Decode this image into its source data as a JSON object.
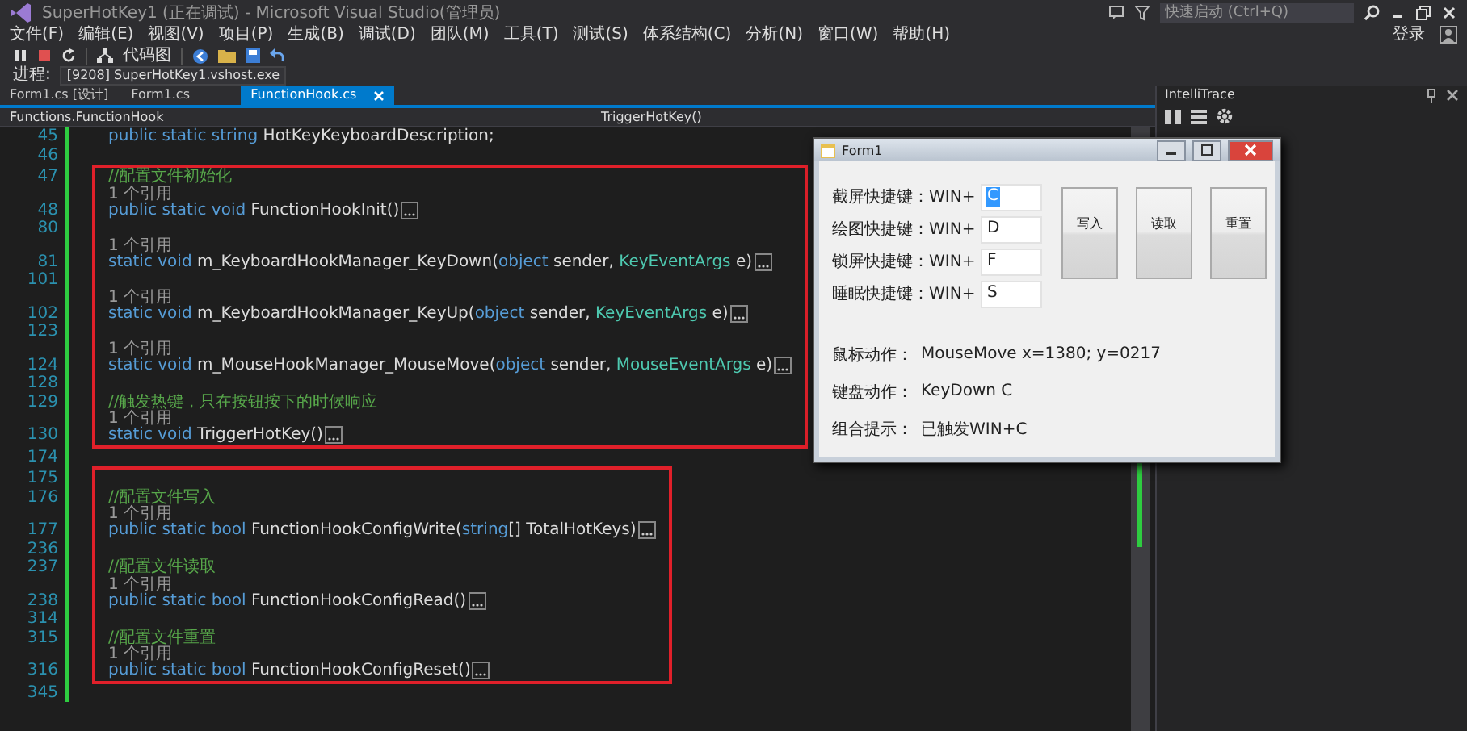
{
  "window": {
    "title": "SuperHotKey1 (正在调试) - Microsoft Visual Studio(管理员)",
    "quick_launch": {
      "placeholder": "快速启动 (Ctrl+Q)"
    },
    "sign_in": "登录"
  },
  "menu": [
    "文件(F)",
    "编辑(E)",
    "视图(V)",
    "项目(P)",
    "生成(B)",
    "调试(D)",
    "团队(M)",
    "工具(T)",
    "测试(S)",
    "体系结构(C)",
    "分析(N)",
    "窗口(W)",
    "帮助(H)"
  ],
  "toolbar": {
    "code_map": "代码图"
  },
  "process": {
    "label": "进程:",
    "value": "[9208] SuperHotKey1.vshost.exe"
  },
  "tabs": [
    {
      "label": "Form1.cs [设计]",
      "selected": false
    },
    {
      "label": "Form1.cs",
      "selected": false
    },
    {
      "label": "FunctionHook.cs",
      "selected": true
    }
  ],
  "nav": {
    "class": "Functions.FunctionHook",
    "member": "TriggerHotKey()"
  },
  "code_groups": [
    {
      "boxed": false,
      "lines": [
        {
          "number": "45",
          "tokens": [
            {
              "kind": "keyword",
              "text": "public static string "
            },
            {
              "kind": "plain",
              "text": "HotKeyKeyboardDescription;"
            }
          ]
        },
        {
          "number": "46"
        }
      ]
    },
    {
      "boxed": true,
      "lines": [
        {
          "number": "47",
          "tokens": [
            {
              "kind": "comment",
              "text": "//配置文件初始化"
            }
          ]
        },
        {
          "number": "48",
          "codelens": "1 个引用",
          "collapsed": true,
          "tokens": [
            {
              "kind": "keyword",
              "text": "public static void "
            },
            {
              "kind": "plain",
              "text": "FunctionHookInit()"
            }
          ]
        },
        {
          "number": "80"
        },
        {
          "number": "81",
          "codelens": "1 个引用",
          "collapsed": true,
          "tokens": [
            {
              "kind": "keyword",
              "text": "static void "
            },
            {
              "kind": "plain",
              "text": "m_KeyboardHookManager_KeyDown("
            },
            {
              "kind": "keyword",
              "text": "object "
            },
            {
              "kind": "plain",
              "text": "sender, "
            },
            {
              "kind": "type",
              "text": "KeyEventArgs "
            },
            {
              "kind": "plain",
              "text": "e)"
            }
          ]
        },
        {
          "number": "101"
        },
        {
          "number": "102",
          "codelens": "1 个引用",
          "collapsed": true,
          "tokens": [
            {
              "kind": "keyword",
              "text": "static void "
            },
            {
              "kind": "plain",
              "text": "m_KeyboardHookManager_KeyUp("
            },
            {
              "kind": "keyword",
              "text": "object "
            },
            {
              "kind": "plain",
              "text": "sender, "
            },
            {
              "kind": "type",
              "text": "KeyEventArgs "
            },
            {
              "kind": "plain",
              "text": "e)"
            }
          ]
        },
        {
          "number": "123"
        },
        {
          "number": "124",
          "codelens": "1 个引用",
          "collapsed": true,
          "tokens": [
            {
              "kind": "keyword",
              "text": "static void "
            },
            {
              "kind": "plain",
              "text": "m_MouseHookManager_MouseMove("
            },
            {
              "kind": "keyword",
              "text": "object "
            },
            {
              "kind": "plain",
              "text": "sender, "
            },
            {
              "kind": "type",
              "text": "MouseEventArgs "
            },
            {
              "kind": "plain",
              "text": "e)"
            }
          ]
        },
        {
          "number": "128"
        },
        {
          "number": "129",
          "tokens": [
            {
              "kind": "comment",
              "text": "//触发热键，只在按钮按下的时候响应"
            }
          ]
        },
        {
          "number": "130",
          "codelens": "1 个引用",
          "collapsed": true,
          "tokens": [
            {
              "kind": "keyword",
              "text": "static void "
            },
            {
              "kind": "plain",
              "text": "TriggerHotKey()"
            }
          ]
        }
      ]
    },
    {
      "boxed": false,
      "lines": [
        {
          "number": "174"
        }
      ]
    },
    {
      "boxed": true,
      "lines": [
        {
          "number": "175"
        },
        {
          "number": "176",
          "tokens": [
            {
              "kind": "comment",
              "text": "//配置文件写入"
            }
          ]
        },
        {
          "number": "177",
          "codelens": "1 个引用",
          "collapsed": true,
          "tokens": [
            {
              "kind": "keyword",
              "text": "public static bool "
            },
            {
              "kind": "plain",
              "text": "FunctionHookConfigWrite("
            },
            {
              "kind": "keyword",
              "text": "string"
            },
            {
              "kind": "plain",
              "text": "[] TotalHotKeys)"
            }
          ]
        },
        {
          "number": "236"
        },
        {
          "number": "237",
          "tokens": [
            {
              "kind": "comment",
              "text": "//配置文件读取"
            }
          ]
        },
        {
          "number": "238",
          "codelens": "1 个引用",
          "collapsed": true,
          "tokens": [
            {
              "kind": "keyword",
              "text": "public static bool "
            },
            {
              "kind": "plain",
              "text": "FunctionHookConfigRead()"
            }
          ]
        },
        {
          "number": "314"
        },
        {
          "number": "315",
          "tokens": [
            {
              "kind": "comment",
              "text": "//配置文件重置"
            }
          ]
        },
        {
          "number": "316",
          "codelens": "1 个引用",
          "collapsed": true,
          "tokens": [
            {
              "kind": "keyword",
              "text": "public static bool "
            },
            {
              "kind": "plain",
              "text": "FunctionHookConfigReset()"
            }
          ]
        }
      ]
    },
    {
      "boxed": false,
      "lines": [
        {
          "number": "345"
        }
      ]
    }
  ],
  "side_panel": {
    "title": "IntelliTrace"
  },
  "form": {
    "title": "Form1",
    "hotkeys": [
      {
        "label": "截屏快捷键：WIN+",
        "value": "C",
        "selected": true
      },
      {
        "label": "绘图快捷键：WIN+",
        "value": "D",
        "selected": false
      },
      {
        "label": "锁屏快捷键：WIN+",
        "value": "F",
        "selected": false
      },
      {
        "label": "睡眠快捷键：WIN+",
        "value": "S",
        "selected": false
      }
    ],
    "buttons": [
      "写入",
      "读取",
      "重置"
    ],
    "status": [
      {
        "label": "鼠标动作：",
        "value": "MouseMove x=1380; y=0217"
      },
      {
        "label": "键盘动作：",
        "value": "KeyDown  C"
      },
      {
        "label": "组合提示：",
        "value": "已触发WIN+C"
      }
    ]
  }
}
